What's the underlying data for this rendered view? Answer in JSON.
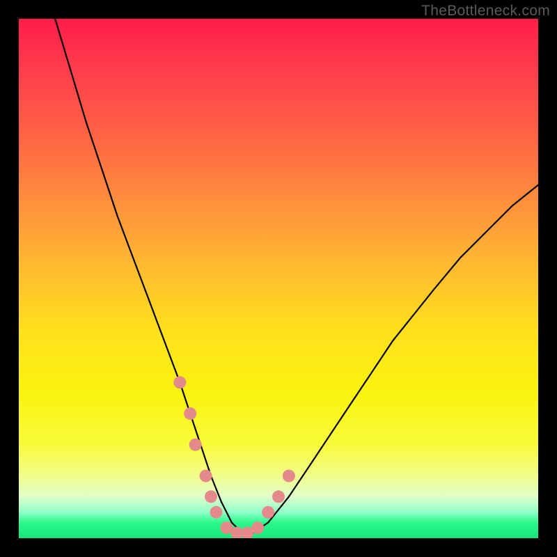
{
  "watermark": "TheBottleneck.com",
  "chart_data": {
    "type": "line",
    "title": "",
    "xlabel": "",
    "ylabel": "",
    "xlim": [
      0,
      100
    ],
    "ylim": [
      0,
      100
    ],
    "grid": false,
    "series": [
      {
        "name": "bottleneck-curve",
        "x": [
          7,
          10,
          13,
          16,
          19,
          22,
          25,
          28,
          31,
          33,
          35,
          37,
          39,
          41,
          43,
          45,
          48,
          52,
          56,
          60,
          64,
          68,
          72,
          76,
          80,
          85,
          90,
          95,
          100
        ],
        "y": [
          100,
          90,
          80,
          71,
          62,
          54,
          46,
          38,
          30,
          24,
          18,
          12,
          7,
          3,
          1,
          1,
          3,
          8,
          14,
          20,
          26,
          32,
          38,
          43,
          48,
          54,
          59,
          64,
          68
        ]
      }
    ],
    "markers": {
      "name": "highlight-dots",
      "color": "#e58a8a",
      "points": [
        {
          "x": 31,
          "y": 30
        },
        {
          "x": 33,
          "y": 24
        },
        {
          "x": 34,
          "y": 18
        },
        {
          "x": 36,
          "y": 12
        },
        {
          "x": 37,
          "y": 8
        },
        {
          "x": 38,
          "y": 5
        },
        {
          "x": 40,
          "y": 2
        },
        {
          "x": 42,
          "y": 1
        },
        {
          "x": 44,
          "y": 1
        },
        {
          "x": 46,
          "y": 2
        },
        {
          "x": 48,
          "y": 5
        },
        {
          "x": 50,
          "y": 8
        },
        {
          "x": 52,
          "y": 12
        }
      ]
    },
    "gradient_stops": [
      {
        "pos": 0,
        "color": "#ff1d4a"
      },
      {
        "pos": 10,
        "color": "#ff3e4d"
      },
      {
        "pos": 22,
        "color": "#ff6245"
      },
      {
        "pos": 34,
        "color": "#ff8b3e"
      },
      {
        "pos": 46,
        "color": "#ffb533"
      },
      {
        "pos": 60,
        "color": "#ffe01c"
      },
      {
        "pos": 72,
        "color": "#faf30f"
      },
      {
        "pos": 82,
        "color": "#f8fb3a"
      },
      {
        "pos": 88,
        "color": "#f2fd8b"
      },
      {
        "pos": 92,
        "color": "#e0ffca"
      },
      {
        "pos": 95,
        "color": "#90ffc9"
      },
      {
        "pos": 97,
        "color": "#2cf98a"
      },
      {
        "pos": 100,
        "color": "#15e67c"
      }
    ]
  }
}
